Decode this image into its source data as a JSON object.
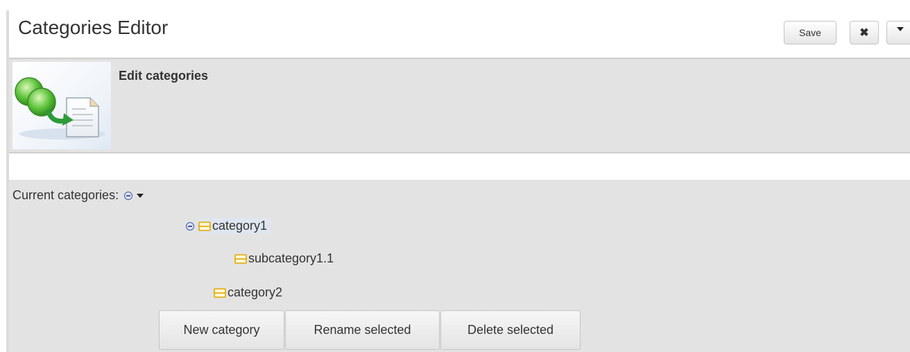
{
  "header": {
    "title": "Categories Editor",
    "save_label": "Save",
    "close_label": "✖"
  },
  "banner": {
    "heading": "Edit categories"
  },
  "tree": {
    "label": "Current categories:",
    "items": [
      {
        "label": "category1",
        "expanded": true,
        "selected": true
      },
      {
        "label": "subcategory1.1"
      },
      {
        "label": "category2"
      }
    ]
  },
  "actions": {
    "new_label": "New category",
    "rename_label": "Rename selected",
    "delete_label": "Delete selected"
  },
  "colors": {
    "accent_blue": "#3a5ab0",
    "folder_yellow": "#e0a800"
  }
}
